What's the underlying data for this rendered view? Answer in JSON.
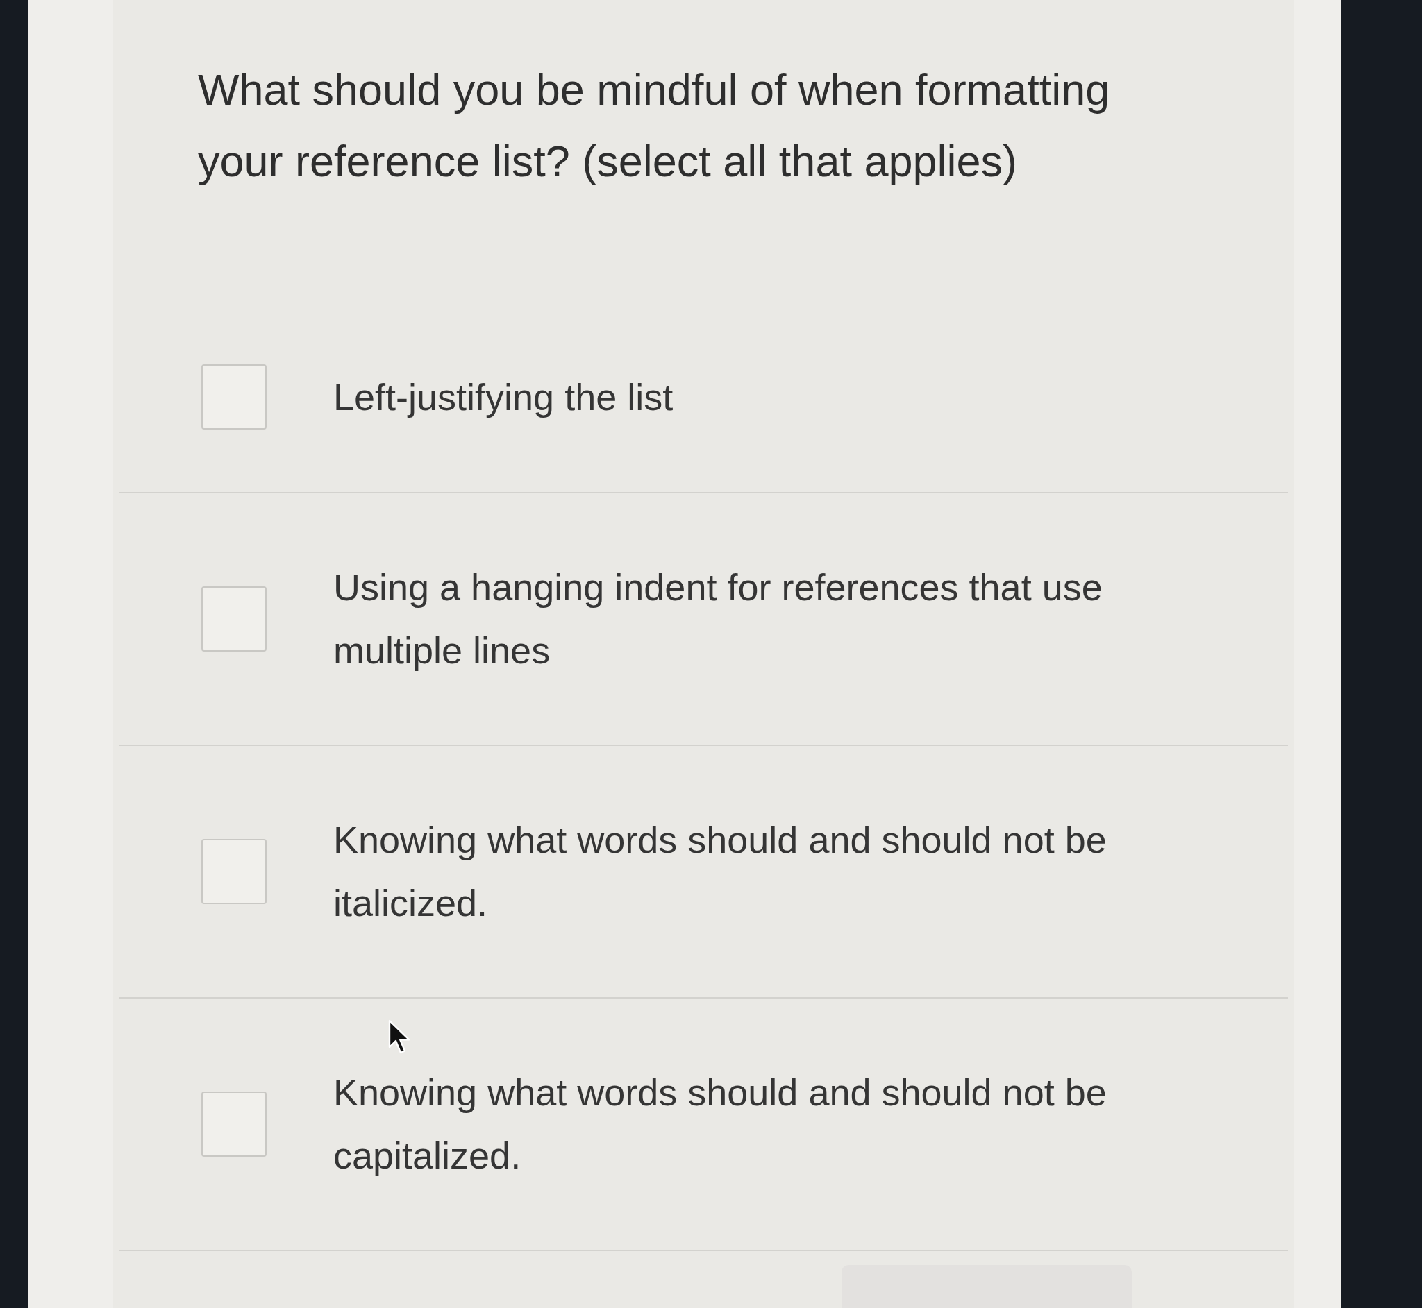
{
  "question": {
    "text": "What should you be mindful of when formatting your reference list? (select all that applies)"
  },
  "options": [
    {
      "label": "Left-justifying the list",
      "checked": false
    },
    {
      "label": "Using a hanging indent for references that use multiple lines",
      "checked": false
    },
    {
      "label": "Knowing what words should and should not be italicized.",
      "checked": false
    },
    {
      "label": "Knowing what words should and should not be capitalized.",
      "checked": false
    }
  ]
}
